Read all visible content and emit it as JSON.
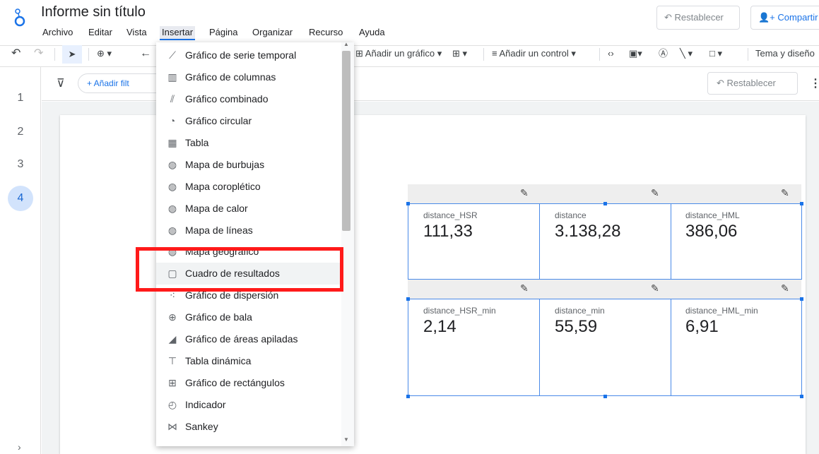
{
  "header": {
    "title": "Informe sin título",
    "menus": [
      "Archivo",
      "Editar",
      "Vista",
      "Insertar",
      "Página",
      "Organizar",
      "Recurso",
      "Ayuda"
    ],
    "reset_label": "Restablecer",
    "share_label": "Compartir"
  },
  "toolbar": {
    "add_chart": "Añadir un gráfico",
    "add_control": "Añadir un control",
    "theme": "Tema y diseño"
  },
  "filterbar": {
    "add_filter": "+ Añadir filt",
    "reset_label": "Restablecer"
  },
  "pages": [
    "1",
    "2",
    "3",
    "4"
  ],
  "scorecards": [
    {
      "label": "distance_HSR",
      "value": "111,33"
    },
    {
      "label": "distance",
      "value": "3.138,28"
    },
    {
      "label": "distance_HML",
      "value": "386,06"
    },
    {
      "label": "distance_HSR_min",
      "value": "2,14"
    },
    {
      "label": "distance_min",
      "value": "55,59"
    },
    {
      "label": "distance_HML_min",
      "value": "6,91"
    }
  ],
  "insert_menu": [
    {
      "label": "Gráfico de serie temporal",
      "icon": "timeseries-icon"
    },
    {
      "label": "Gráfico de columnas",
      "icon": "column-chart-icon"
    },
    {
      "label": "Gráfico combinado",
      "icon": "combo-chart-icon"
    },
    {
      "label": "Gráfico circular",
      "icon": "pie-chart-icon"
    },
    {
      "label": "Tabla",
      "icon": "table-icon"
    },
    {
      "label": "Mapa de burbujas",
      "icon": "globe-icon"
    },
    {
      "label": "Mapa coroplético",
      "icon": "globe-icon"
    },
    {
      "label": "Mapa de calor",
      "icon": "globe-icon"
    },
    {
      "label": "Mapa de líneas",
      "icon": "globe-icon"
    },
    {
      "label": "Mapa geográfico",
      "icon": "globe-icon"
    },
    {
      "label": "Cuadro de resultados",
      "icon": "scorecard-icon"
    },
    {
      "label": "Gráfico de dispersión",
      "icon": "scatter-icon"
    },
    {
      "label": "Gráfico de bala",
      "icon": "bullet-chart-icon"
    },
    {
      "label": "Gráfico de áreas apiladas",
      "icon": "area-chart-icon"
    },
    {
      "label": "Tabla dinámica",
      "icon": "pivot-table-icon"
    },
    {
      "label": "Gráfico de rectángulos",
      "icon": "treemap-icon"
    },
    {
      "label": "Indicador",
      "icon": "gauge-icon"
    },
    {
      "label": "Sankey",
      "icon": "sankey-icon"
    }
  ],
  "highlighted_item": "Cuadro de resultados",
  "colors": {
    "accent": "#1a73e8",
    "highlight_box": "#ff1a1a"
  }
}
